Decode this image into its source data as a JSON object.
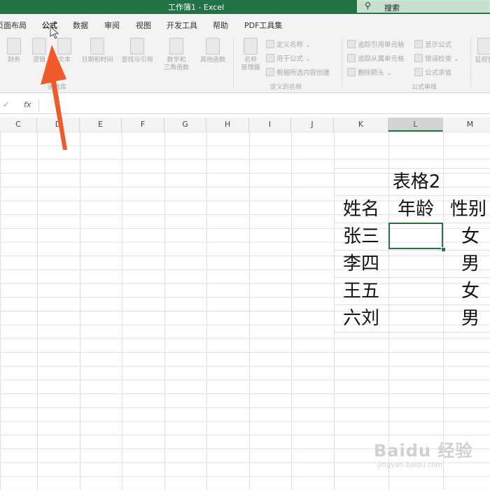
{
  "window": {
    "title": "工作簿1 - Excel",
    "search_placeholder": "搜索"
  },
  "tabs": [
    {
      "label": "页面布局"
    },
    {
      "label": "公式",
      "active": true
    },
    {
      "label": "数据"
    },
    {
      "label": "审阅"
    },
    {
      "label": "视图"
    },
    {
      "label": "开发工具"
    },
    {
      "label": "帮助"
    },
    {
      "label": "PDF工具集"
    }
  ],
  "ribbon": {
    "library": {
      "buttons": [
        "财务",
        "逻辑",
        "文本",
        "日期和时间",
        "查找与引用",
        "数学和\n三角函数",
        "其他函数"
      ],
      "group_label": "函数库"
    },
    "names": {
      "manager": "名称\n管理器",
      "define": "定义名称",
      "use_in_formula": "用于公式",
      "create_from_selection": "根据所选内容创建",
      "group_label": "定义的名称"
    },
    "audit": {
      "trace_precedents": "追踪引用单元格",
      "trace_dependents": "追踪从属单元格",
      "remove_arrows": "删除箭头",
      "show_formulas": "显示公式",
      "error_checking": "错误检查",
      "evaluate_formula": "公式求值",
      "watch_window": "监视窗",
      "group_label": "公式审核"
    }
  },
  "formula_bar": {
    "check": "✓",
    "fx": "fx"
  },
  "columns": [
    "C",
    "D",
    "E",
    "F",
    "G",
    "H",
    "I",
    "J",
    "K",
    "L",
    "M"
  ],
  "selected_column": "L",
  "table": {
    "title": "表格2",
    "headers": [
      "姓名",
      "年龄",
      "性别"
    ],
    "rows": [
      [
        "张三",
        "",
        "女"
      ],
      [
        "李四",
        "",
        "男"
      ],
      [
        "王五",
        "",
        "女"
      ],
      [
        "六刘",
        "",
        "男"
      ]
    ]
  },
  "colors": {
    "accent": "#217346",
    "arrow": "#f05a28"
  }
}
